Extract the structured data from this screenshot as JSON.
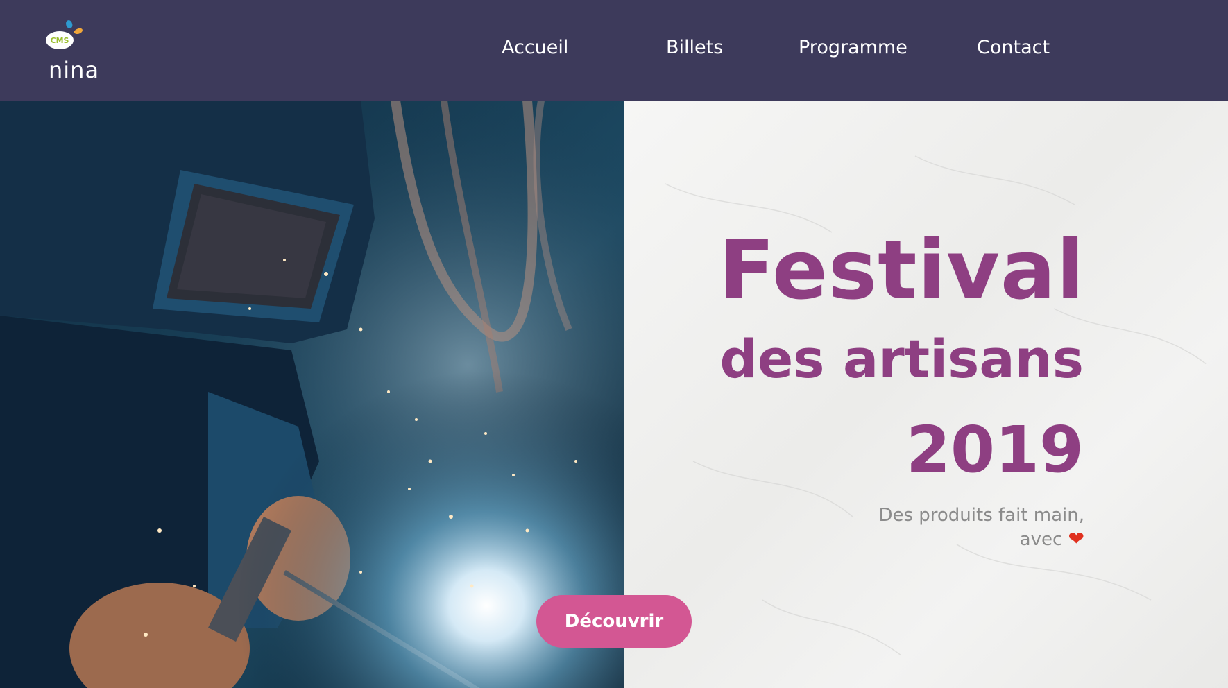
{
  "header": {
    "logo": {
      "badge": "CMS",
      "name": "nina"
    },
    "nav": [
      {
        "label": "Accueil"
      },
      {
        "label": "Billets"
      },
      {
        "label": "Programme"
      },
      {
        "label": "Contact"
      }
    ]
  },
  "hero": {
    "image": {
      "subject": "welder-with-sparks"
    },
    "title": {
      "line1": "Festival",
      "line2": "des artisans",
      "line3": "2019"
    },
    "tagline": {
      "line1": "Des produits fait main,",
      "line2": "avec",
      "heart_icon": "heart-icon"
    },
    "cta_label": "Découvrir"
  },
  "colors": {
    "header_bg": "#3d3a5b",
    "title": "#8e3f82",
    "cta_bg": "#d35793",
    "tagline": "#8b8b8b",
    "heart": "#e0301e"
  }
}
